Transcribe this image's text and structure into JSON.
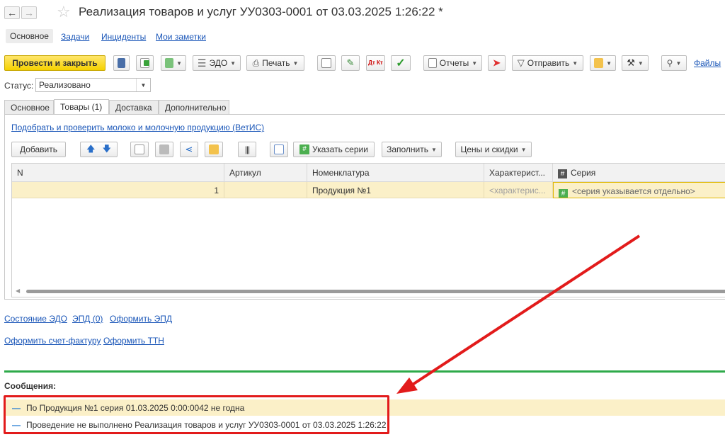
{
  "window": {
    "title": "Реализация товаров и услуг УУ0303-0001 от 03.03.2025 1:26:22 *"
  },
  "sections": [
    {
      "label": "Основное"
    },
    {
      "label": "Задачи"
    },
    {
      "label": "Инциденты"
    },
    {
      "label": "Мои заметки"
    }
  ],
  "toolbar": {
    "post_close": "Провести и закрыть",
    "edo": "ЭДО",
    "print": "Печать",
    "reports": "Отчеты",
    "send": "Отправить",
    "files": "Файлы",
    "dt_kt": "Дт Кт"
  },
  "status": {
    "label": "Статус:",
    "value": "Реализовано"
  },
  "form_tabs": [
    {
      "label": "Основное"
    },
    {
      "label": "Товары (1)"
    },
    {
      "label": "Доставка"
    },
    {
      "label": "Дополнительно"
    }
  ],
  "goods": {
    "vetis_link": "Подобрать и проверить молоко и молочную продукцию (ВетИС)",
    "add_button": "Добавить",
    "specify_series": "Указать серии",
    "fill": "Заполнить",
    "prices_discounts": "Цены и скидки",
    "series_icon": "#",
    "columns": [
      "N",
      "Артикул",
      "Номенклатура",
      "Характерист...",
      "Серия"
    ],
    "rows": [
      {
        "n": "1",
        "article": "",
        "nomenclature": "Продукция №1",
        "characteristic": "<характерис...",
        "series": "<серия указывается отдельно>"
      }
    ]
  },
  "bottom_links": {
    "edo_state": "Состояние ЭДО",
    "epd": "ЭПД (0)",
    "make_epd": "Оформить ЭПД",
    "make_invoice": "Оформить счет-фактуру",
    "make_ttn": "Оформить ТТН"
  },
  "messages": {
    "title": "Сообщения:",
    "items": [
      {
        "text": "По Продукция №1 серия 01.03.2025 0:00:0042 не годна"
      },
      {
        "text": "Проведение не выполнено Реализация товаров и услуг УУ0303-0001 от 03.03.2025 1:26:22"
      }
    ]
  },
  "colors": {
    "primary_button": "#f5d200",
    "link": "#1a56b8",
    "row_highlight": "#fbf0c8",
    "separator": "#2eaa4a",
    "annotation": "#e21b1b"
  }
}
